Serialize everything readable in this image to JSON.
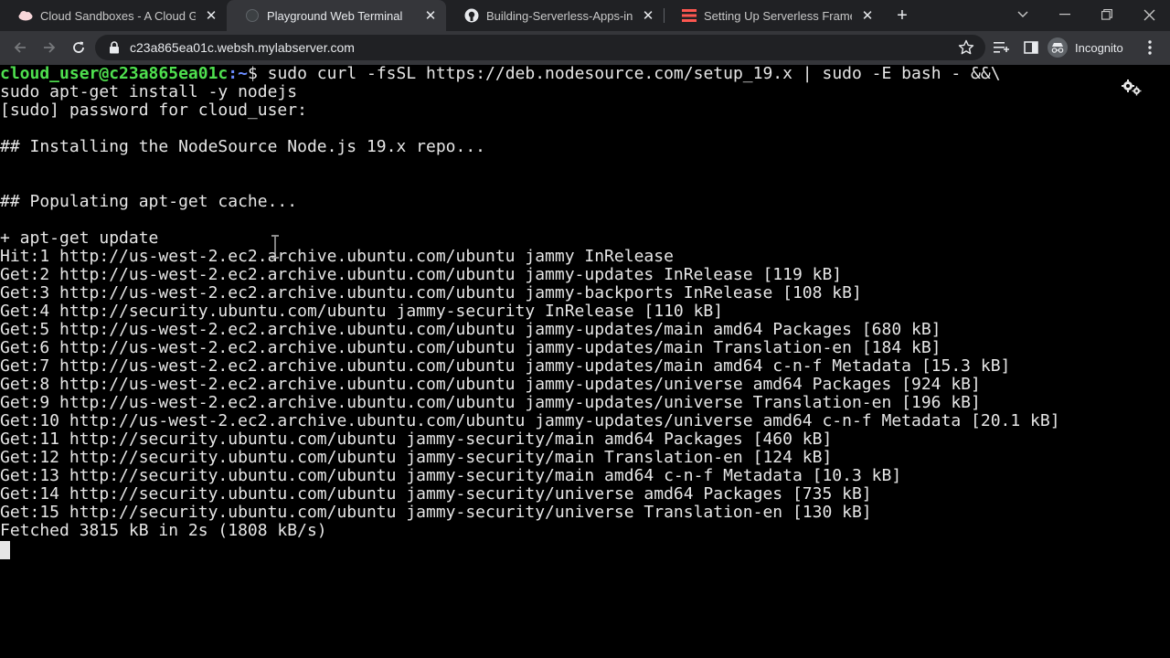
{
  "tabs": [
    {
      "title": "Cloud Sandboxes - A Cloud Guru",
      "favicon": "cloud-icon",
      "active": false
    },
    {
      "title": "Playground Web Terminal",
      "favicon": "terminal-globe-icon",
      "active": true
    },
    {
      "title": "Building-Serverless-Apps-in-AWS",
      "favicon": "github-icon",
      "active": false
    },
    {
      "title": "Setting Up Serverless Framework",
      "favicon": "serverless-icon",
      "active": false
    }
  ],
  "toolbar": {
    "url": "c23a865ea01c.websh.mylabserver.com",
    "profile_label": "Incognito"
  },
  "terminal": {
    "prompt_user_host": "cloud_user@c23a865ea01c",
    "prompt_path": ":~",
    "prompt_symbol": "$",
    "command_first_line": " sudo curl -fsSL https://deb.nodesource.com/setup_19.x | sudo -E bash - &&\\",
    "lines": [
      "sudo apt-get install -y nodejs",
      "[sudo] password for cloud_user:",
      "",
      "## Installing the NodeSource Node.js 19.x repo...",
      "",
      "",
      "## Populating apt-get cache...",
      "",
      "+ apt-get update",
      "Hit:1 http://us-west-2.ec2.archive.ubuntu.com/ubuntu jammy InRelease",
      "Get:2 http://us-west-2.ec2.archive.ubuntu.com/ubuntu jammy-updates InRelease [119 kB]",
      "Get:3 http://us-west-2.ec2.archive.ubuntu.com/ubuntu jammy-backports InRelease [108 kB]",
      "Get:4 http://security.ubuntu.com/ubuntu jammy-security InRelease [110 kB]",
      "Get:5 http://us-west-2.ec2.archive.ubuntu.com/ubuntu jammy-updates/main amd64 Packages [680 kB]",
      "Get:6 http://us-west-2.ec2.archive.ubuntu.com/ubuntu jammy-updates/main Translation-en [184 kB]",
      "Get:7 http://us-west-2.ec2.archive.ubuntu.com/ubuntu jammy-updates/main amd64 c-n-f Metadata [15.3 kB]",
      "Get:8 http://us-west-2.ec2.archive.ubuntu.com/ubuntu jammy-updates/universe amd64 Packages [924 kB]",
      "Get:9 http://us-west-2.ec2.archive.ubuntu.com/ubuntu jammy-updates/universe Translation-en [196 kB]",
      "Get:10 http://us-west-2.ec2.archive.ubuntu.com/ubuntu jammy-updates/universe amd64 c-n-f Metadata [20.1 kB]",
      "Get:11 http://security.ubuntu.com/ubuntu jammy-security/main amd64 Packages [460 kB]",
      "Get:12 http://security.ubuntu.com/ubuntu jammy-security/main Translation-en [124 kB]",
      "Get:13 http://security.ubuntu.com/ubuntu jammy-security/main amd64 c-n-f Metadata [10.3 kB]",
      "Get:14 http://security.ubuntu.com/ubuntu jammy-security/universe amd64 Packages [735 kB]",
      "Get:15 http://security.ubuntu.com/ubuntu jammy-security/universe Translation-en [130 kB]",
      "Fetched 3815 kB in 2s (1808 kB/s)"
    ]
  },
  "colors": {
    "tabstrip_bg": "#202124",
    "toolbar_bg": "#35363a",
    "terminal_bg": "#000000",
    "terminal_fg": "#e6e6e6",
    "prompt_user": "#4fe04f",
    "prompt_path": "#6b8cff"
  }
}
